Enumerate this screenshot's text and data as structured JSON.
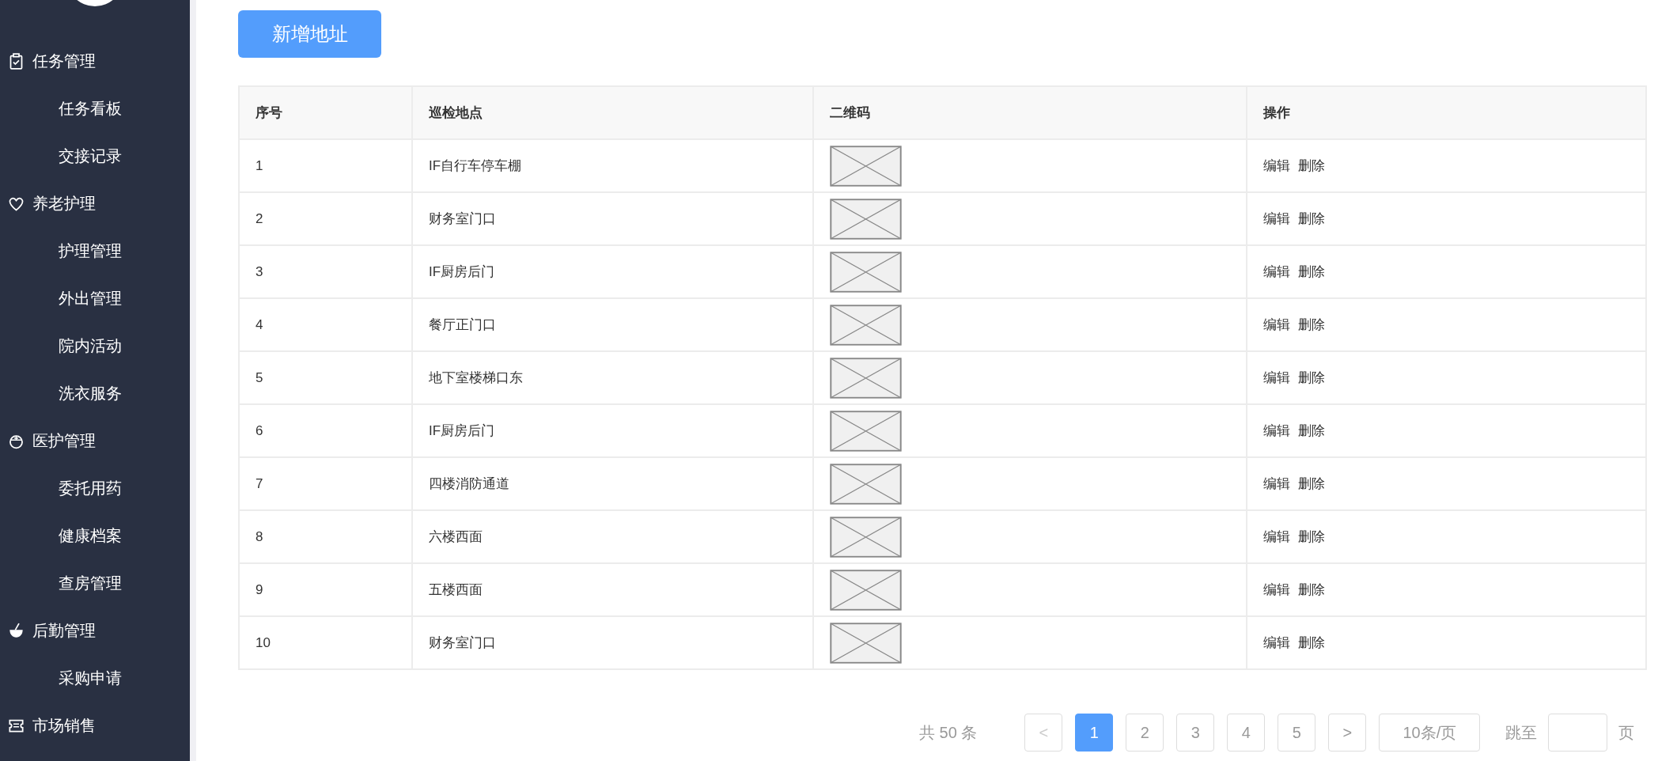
{
  "sidebar": {
    "groups": [
      {
        "label": "任务管理",
        "items": [
          {
            "label": "任务看板"
          },
          {
            "label": "交接记录"
          }
        ]
      },
      {
        "label": "养老护理",
        "items": [
          {
            "label": "护理管理"
          },
          {
            "label": "外出管理"
          },
          {
            "label": "院内活动"
          },
          {
            "label": "洗衣服务"
          }
        ]
      },
      {
        "label": "医护管理",
        "items": [
          {
            "label": "委托用药"
          },
          {
            "label": "健康档案"
          },
          {
            "label": "查房管理"
          }
        ]
      },
      {
        "label": "后勤管理",
        "items": [
          {
            "label": "采购申请"
          }
        ]
      },
      {
        "label": "市场销售"
      }
    ]
  },
  "add_button": "新增地址",
  "table": {
    "columns": [
      "序号",
      "巡检地点",
      "二维码",
      "操作"
    ],
    "rows": [
      {
        "index": "1",
        "location": "IF自行车停车棚",
        "actions": [
          "编辑",
          "删除"
        ]
      },
      {
        "index": "2",
        "location": "财务室门口",
        "actions": [
          "编辑",
          "删除"
        ]
      },
      {
        "index": "3",
        "location": "IF厨房后门",
        "actions": [
          "编辑",
          "删除"
        ]
      },
      {
        "index": "4",
        "location": "餐厅正门口",
        "actions": [
          "编辑",
          "删除"
        ]
      },
      {
        "index": "5",
        "location": "地下室楼梯口东",
        "actions": [
          "编辑",
          "删除"
        ]
      },
      {
        "index": "6",
        "location": "IF厨房后门",
        "actions": [
          "编辑",
          "删除"
        ]
      },
      {
        "index": "7",
        "location": "四楼消防通道",
        "actions": [
          "编辑",
          "删除"
        ]
      },
      {
        "index": "8",
        "location": "六楼西面",
        "actions": [
          "编辑",
          "删除"
        ]
      },
      {
        "index": "9",
        "location": "五楼西面",
        "actions": [
          "编辑",
          "删除"
        ]
      },
      {
        "index": "10",
        "location": "财务室门口",
        "actions": [
          "编辑",
          "删除"
        ]
      }
    ]
  },
  "pagination": {
    "total": "共 50 条",
    "prev": {
      "label": "<",
      "disabled": true
    },
    "pages": [
      {
        "label": "1",
        "selected": true
      },
      {
        "label": "2",
        "selected": false
      },
      {
        "label": "3",
        "selected": false
      },
      {
        "label": "4",
        "selected": false
      },
      {
        "label": "5",
        "selected": false
      }
    ],
    "next": {
      "label": ">",
      "disabled": false
    },
    "page_size": "10条/页",
    "jump_label": "跳至",
    "jump_suffix": "页"
  }
}
